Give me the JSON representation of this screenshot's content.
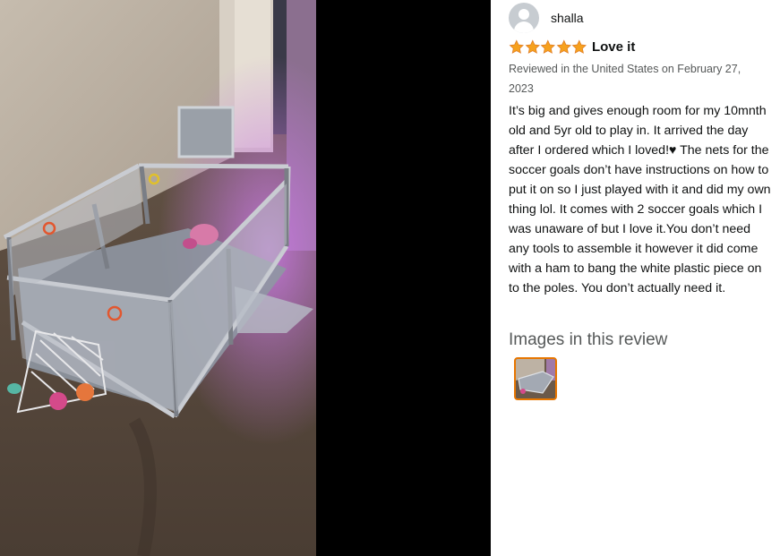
{
  "review": {
    "author": "shalla",
    "rating": 5,
    "rating_max": 5,
    "title": "Love it",
    "meta": "Reviewed in the United States on February 27, 2023",
    "body": "It’s big and gives enough room for my 10mnth old and 5yr old to play in. It arrived the day after I ordered which I loved!♥ The nets for the soccer goals don’t have instructions on how to put it on so I just played with it and did my own thing lol. It comes with 2 soccer goals which I was unaware of but I love it.You don’t need any tools to assemble it however it did come with a ham to bang the white plastic piece on to the poles. You don’t actually need it.",
    "images_heading": "Images in this review"
  },
  "colors": {
    "star": "#f6a11e",
    "thumb_border": "#e77600",
    "avatar": "#c7ccd1",
    "viewer_background": "#000000"
  },
  "icons": {
    "avatar": "default-user-icon",
    "star": "star-filled-icon"
  }
}
